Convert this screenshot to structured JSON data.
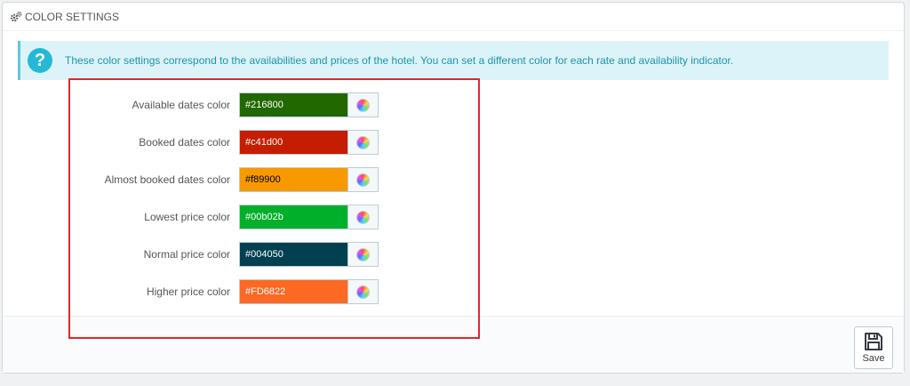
{
  "panel": {
    "title": "COLOR SETTINGS"
  },
  "alert": {
    "text": "These color settings correspond to the availabilities and prices of the hotel. You can set a different color for each rate and availability indicator."
  },
  "colors": [
    {
      "label": "Available dates color",
      "value": "#216800",
      "bg": "#216800",
      "fg": "#ffffff"
    },
    {
      "label": "Booked dates color",
      "value": "#c41d00",
      "bg": "#c41d00",
      "fg": "#ffffff"
    },
    {
      "label": "Almost booked dates color",
      "value": "#f89900",
      "bg": "#f89900",
      "fg": "#000000"
    },
    {
      "label": "Lowest price color",
      "value": "#00b02b",
      "bg": "#00b02b",
      "fg": "#ffffff"
    },
    {
      "label": "Normal price color",
      "value": "#004050",
      "bg": "#004050",
      "fg": "#ffffff"
    },
    {
      "label": "Higher price color",
      "value": "#FD6822",
      "bg": "#FD6822",
      "fg": "#ffffff"
    }
  ],
  "footer": {
    "save_label": "Save"
  }
}
